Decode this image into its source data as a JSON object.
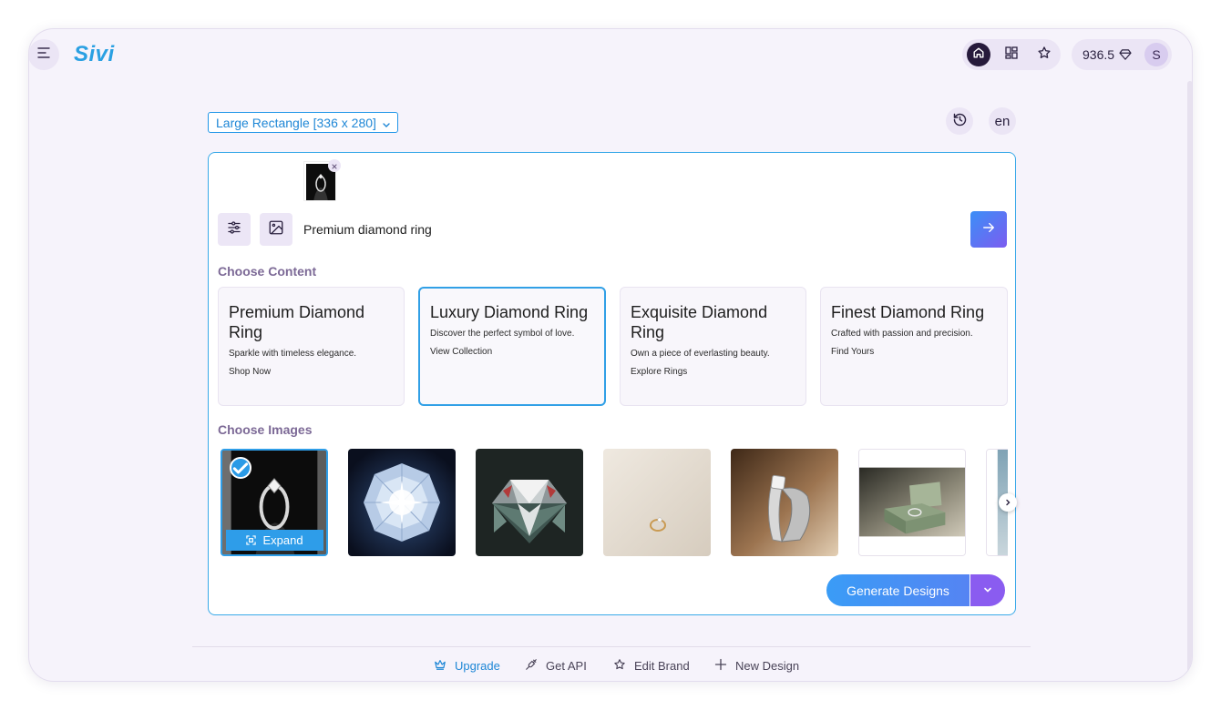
{
  "app": {
    "logo": "Sivi"
  },
  "header": {
    "credits": "936.5",
    "avatar_initial": "S",
    "icons": [
      "menu-icon",
      "home-icon",
      "grid-icon",
      "star-icon",
      "diamond-icon"
    ]
  },
  "toolbar": {
    "size_select": "Large Rectangle [336 x 280]",
    "language": "en",
    "icons": [
      "chevron-down-icon",
      "history-icon"
    ]
  },
  "prompt": {
    "value": "Premium diamond ring",
    "icons": [
      "sliders-icon",
      "image-icon",
      "arrow-right-icon",
      "close-icon"
    ]
  },
  "content": {
    "heading": "Choose Content",
    "selected_index": 1,
    "cards": [
      {
        "title": "Premium Diamond Ring",
        "subtitle": "Sparkle with timeless elegance.",
        "cta": "Shop Now"
      },
      {
        "title": "Luxury Diamond Ring",
        "subtitle": "Discover the perfect symbol of love.",
        "cta": "View Collection"
      },
      {
        "title": "Exquisite Diamond Ring",
        "subtitle": "Own a piece of everlasting beauty.",
        "cta": "Explore Rings"
      },
      {
        "title": "Finest Diamond Ring",
        "subtitle": "Crafted with passion and precision.",
        "cta": "Find Yours"
      }
    ]
  },
  "images": {
    "heading": "Choose Images",
    "expand_label": "Expand",
    "selected_index": 0,
    "icons": [
      "check-icon",
      "expand-icon",
      "chevron-right-icon"
    ]
  },
  "actions": {
    "generate_label": "Generate Designs",
    "icons": [
      "chevron-down-icon"
    ]
  },
  "footer": {
    "items": [
      {
        "label": "Upgrade",
        "icon": "crown-icon"
      },
      {
        "label": "Get API",
        "icon": "plug-icon"
      },
      {
        "label": "Edit Brand",
        "icon": "star-icon"
      },
      {
        "label": "New Design",
        "icon": "plus-icon"
      }
    ]
  },
  "colors": {
    "accent": "#2a9be6",
    "gradient_start": "#3a9cf6",
    "gradient_end": "#8a5cf0",
    "background": "#f6f3fb",
    "section_heading": "#7c6996",
    "logo": "#2aa0e2"
  }
}
